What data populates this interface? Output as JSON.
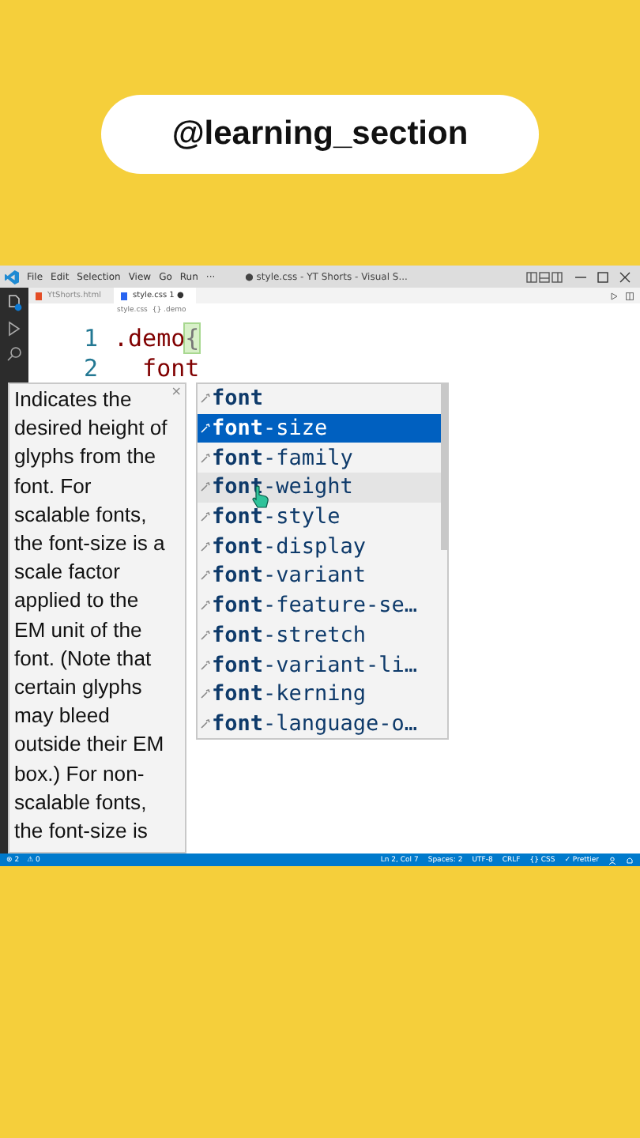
{
  "banner": {
    "handle": "@learning_section"
  },
  "window": {
    "menu": [
      "File",
      "Edit",
      "Selection",
      "View",
      "Go",
      "Run",
      "···"
    ],
    "title": "● style.css - YT Shorts - Visual S..."
  },
  "tabs": [
    {
      "label": "YtShorts.html",
      "kind": "html",
      "selected": false
    },
    {
      "label": "style.css 1",
      "kind": "css",
      "selected": true,
      "badge": "●"
    }
  ],
  "breadcrumb": [
    "style.css",
    "{} .demo"
  ],
  "editor": {
    "lines": [
      {
        "number": "1",
        "code": ".demo",
        "bracket": "{"
      },
      {
        "number": "2",
        "code": "  font"
      }
    ]
  },
  "docs": {
    "close": "×",
    "text": "Indicates the desired height of glyphs from the font. For scalable fonts, the font-size is a scale factor applied to the EM unit of the font. (Note that certain glyphs may bleed outside their EM box.) For non-scalable fonts, the font-size is"
  },
  "suggestions": [
    {
      "label": "**font**",
      "selected": false,
      "hovered": false
    },
    {
      "label": "**font**-size",
      "selected": true,
      "hovered": false
    },
    {
      "label": "**font**-family",
      "selected": false,
      "hovered": false
    },
    {
      "label": "**font**-weight",
      "selected": false,
      "hovered": true
    },
    {
      "label": "**font**-style",
      "selected": false,
      "hovered": false
    },
    {
      "label": "**font**-display",
      "selected": false,
      "hovered": false
    },
    {
      "label": "**font**-variant",
      "selected": false,
      "hovered": false
    },
    {
      "label": "**font**-feature-se…",
      "selected": false,
      "hovered": false
    },
    {
      "label": "**font**-stretch",
      "selected": false,
      "hovered": false
    },
    {
      "label": "**font**-variant-li…",
      "selected": false,
      "hovered": false
    },
    {
      "label": "**font**-kerning",
      "selected": false,
      "hovered": false
    },
    {
      "label": "**font**-language-o…",
      "selected": false,
      "hovered": false
    }
  ],
  "status_bar": {
    "left": [
      "⊗ 2",
      "⚠ 0"
    ],
    "right": [
      "Ln 2, Col 7",
      "Spaces: 2",
      "UTF-8",
      "CRLF",
      "{} CSS",
      "✓ Prettier"
    ]
  }
}
